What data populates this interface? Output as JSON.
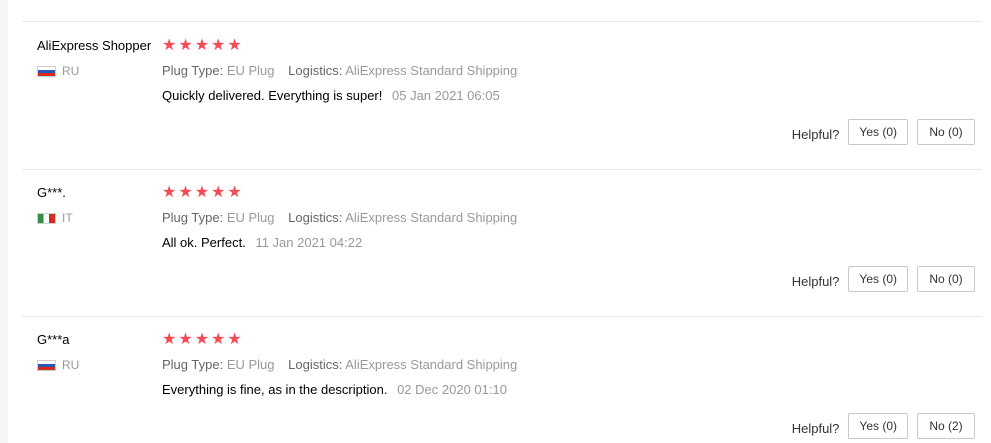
{
  "colors": {
    "star": "#f44b55",
    "divider": "#e8e8e8",
    "muted_text": "#999999"
  },
  "reviews": [
    {
      "user": "AliExpress Shopper",
      "country_code": "RU",
      "flag": "flag-ru-icon",
      "rating": 5,
      "stars": [
        "★",
        "★",
        "★",
        "★",
        "★"
      ],
      "props": {
        "plug_label": "Plug Type:",
        "plug_value": "EU Plug",
        "logistics_label": "Logistics:",
        "logistics_value": "AliExpress Standard Shipping"
      },
      "text": "Quickly delivered. Everything is super!",
      "date": "05 Jan 2021 06:05",
      "helpful_label": "Helpful?",
      "yes_label": "Yes (0)",
      "no_label": "No (0)"
    },
    {
      "user": "G***.",
      "country_code": "IT",
      "flag": "flag-it-icon",
      "rating": 5,
      "stars": [
        "★",
        "★",
        "★",
        "★",
        "★"
      ],
      "props": {
        "plug_label": "Plug Type:",
        "plug_value": "EU Plug",
        "logistics_label": "Logistics:",
        "logistics_value": "AliExpress Standard Shipping"
      },
      "text": "All ok. Perfect.",
      "date": "11 Jan 2021 04:22",
      "helpful_label": "Helpful?",
      "yes_label": "Yes (0)",
      "no_label": "No (0)"
    },
    {
      "user": "G***a",
      "country_code": "RU",
      "flag": "flag-ru-icon",
      "rating": 5,
      "stars": [
        "★",
        "★",
        "★",
        "★",
        "★"
      ],
      "props": {
        "plug_label": "Plug Type:",
        "plug_value": "EU Plug",
        "logistics_label": "Logistics:",
        "logistics_value": "AliExpress Standard Shipping"
      },
      "text": "Everything is fine, as in the description.",
      "date": "02 Dec 2020 01:10",
      "helpful_label": "Helpful?",
      "yes_label": "Yes (0)",
      "no_label": "No (2)"
    }
  ]
}
